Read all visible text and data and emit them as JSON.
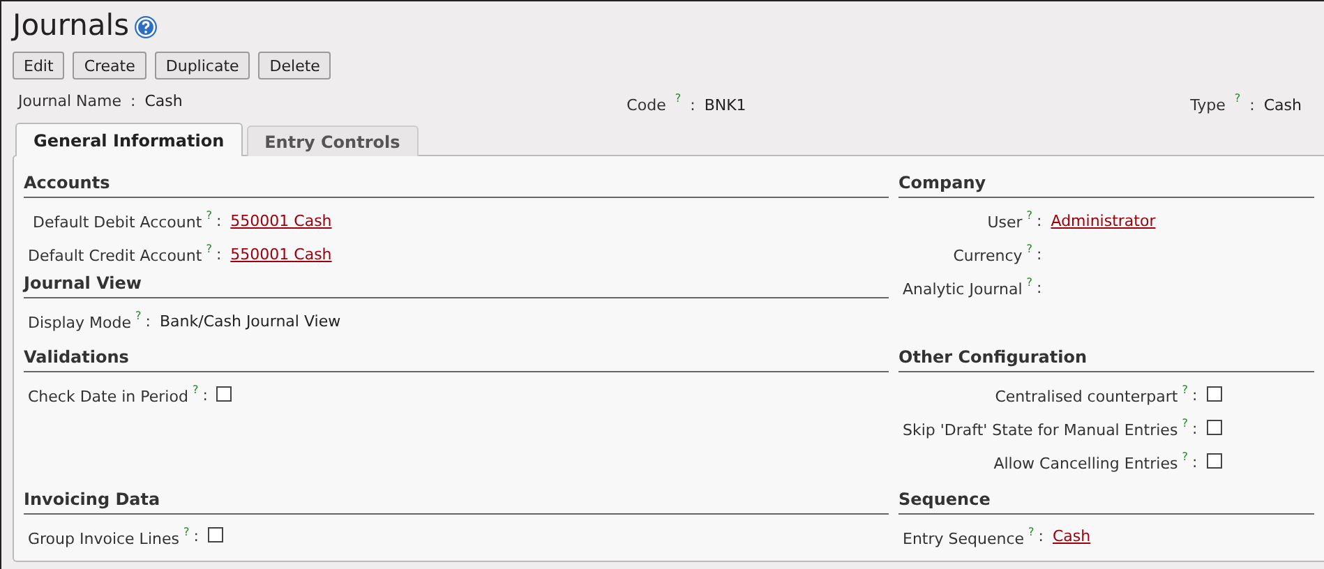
{
  "title": "Journals",
  "buttons": [
    "Edit",
    "Create",
    "Duplicate",
    "Delete"
  ],
  "header_fields": [
    {
      "label": "Journal Name",
      "separator": ":",
      "value": "Cash"
    },
    {
      "label": "Code",
      "help_mark": "?",
      "separator": ":",
      "value": "BNK1"
    },
    {
      "label": "Type",
      "help_mark": "?",
      "separator": ":",
      "value": "Cash"
    }
  ],
  "tabs": [
    {
      "label": "General Information",
      "selected": true
    },
    {
      "label": "Entry Controls",
      "selected": false
    }
  ],
  "form_rows": [
    {
      "left": [
        {
          "title": "Accounts",
          "fields": [
            {
              "label": "Default Debit Account",
              "help_mark": "?",
              "separator": ":",
              "kind": "link",
              "value": "550001 Cash"
            },
            {
              "label": "Default Credit Account",
              "help_mark": "?",
              "separator": ":",
              "kind": "link",
              "value": "550001 Cash"
            }
          ]
        },
        {
          "title": "Journal View",
          "fields": [
            {
              "label": "Display Mode",
              "help_mark": "?",
              "separator": ":",
              "kind": "text",
              "value": "Bank/Cash Journal View"
            }
          ]
        }
      ],
      "right": [
        {
          "title": "Company",
          "fields": [
            {
              "label": "User",
              "help_mark": "?",
              "separator": ":",
              "kind": "link",
              "value": "Administrator"
            },
            {
              "label": "Currency",
              "help_mark": "?",
              "separator": ":",
              "kind": "empty"
            },
            {
              "label": "Analytic Journal",
              "help_mark": "?",
              "separator": ":",
              "kind": "empty"
            }
          ]
        }
      ]
    },
    {
      "left": [
        {
          "title": "Validations",
          "fields": [
            {
              "label": "Check Date in Period",
              "help_mark": "?",
              "separator": ":",
              "kind": "checkbox",
              "checked": false
            }
          ]
        }
      ],
      "right": [
        {
          "title": "Other Configuration",
          "fields": [
            {
              "label": "Centralised counterpart",
              "help_mark": "?",
              "separator": ":",
              "kind": "checkbox",
              "checked": false
            },
            {
              "label": "Skip 'Draft' State for Manual Entries",
              "help_mark": "?",
              "separator": ":",
              "kind": "checkbox",
              "checked": false
            },
            {
              "label": "Allow Cancelling Entries",
              "help_mark": "?",
              "separator": ":",
              "kind": "checkbox",
              "checked": false
            }
          ]
        }
      ]
    },
    {
      "left": [
        {
          "title": "Invoicing Data",
          "fields": [
            {
              "label": "Group Invoice Lines",
              "help_mark": "?",
              "separator": ":",
              "kind": "checkbox",
              "checked": false
            }
          ]
        }
      ],
      "right": [
        {
          "title": "Sequence",
          "fields": [
            {
              "label": "Entry Sequence",
              "help_mark": "?",
              "separator": ":",
              "kind": "link",
              "value": "Cash"
            }
          ]
        }
      ]
    }
  ]
}
